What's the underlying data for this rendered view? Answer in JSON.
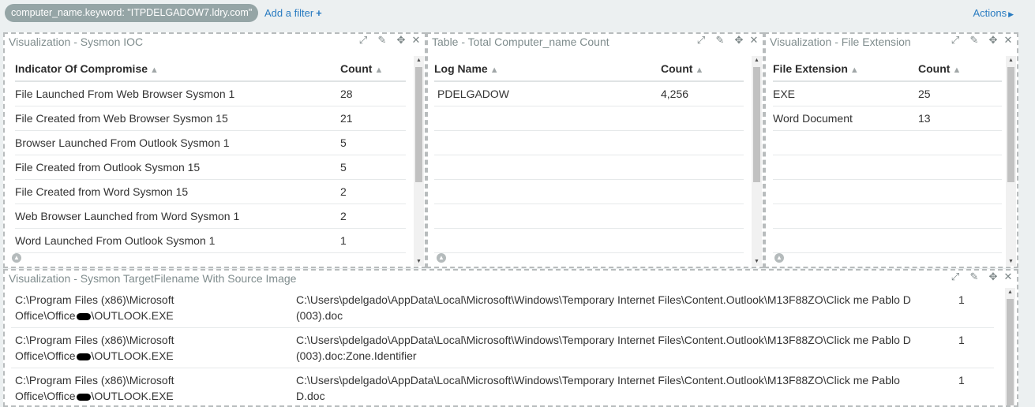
{
  "filter_bar": {
    "filter_pill": "computer_name.keyword: \"ITPDELGADOW7.ldry.com\"",
    "add_filter_label": "Add a filter",
    "add_filter_icon": "plus-icon",
    "actions_label": "Actions",
    "actions_icon": "caret-right-icon"
  },
  "panel_icons": [
    "expand-icon",
    "pencil-icon",
    "move-icon",
    "close-icon"
  ],
  "panel_ioc": {
    "title": "Visualization - Sysmon IOC",
    "columns": [
      "Indicator Of Compromise",
      "Count"
    ],
    "rows": [
      [
        "File Launched From Web Browser Sysmon 1",
        "28"
      ],
      [
        "File Created from Web Browser Sysmon 15",
        "21"
      ],
      [
        "Browser Launched From Outlook Sysmon 1",
        "5"
      ],
      [
        "File Created from Outlook Sysmon 15",
        "5"
      ],
      [
        "File Created from Word Sysmon 15",
        "2"
      ],
      [
        "Web Browser Launched from Word Sysmon 1",
        "2"
      ],
      [
        "Word Launched From Outlook Sysmon 1",
        "1"
      ]
    ]
  },
  "panel_count": {
    "title": "Table - Total Computer_name Count",
    "columns": [
      "Log Name",
      "Count"
    ],
    "rows": [
      [
        "PDELGADOW",
        "4,256"
      ],
      [
        "",
        ""
      ],
      [
        "",
        ""
      ],
      [
        "",
        ""
      ],
      [
        "",
        ""
      ],
      [
        "",
        ""
      ],
      [
        "",
        ""
      ]
    ]
  },
  "panel_ext": {
    "title": "Visualization - File Extension",
    "columns": [
      "File Extension",
      "Count"
    ],
    "rows": [
      [
        "EXE",
        "25"
      ],
      [
        "Word Document",
        "13"
      ],
      [
        "",
        ""
      ],
      [
        "",
        ""
      ],
      [
        "",
        ""
      ],
      [
        "",
        ""
      ],
      [
        "",
        ""
      ]
    ]
  },
  "panel_target": {
    "title": "Visualization - Sysmon TargetFilename With Source Image",
    "rows": [
      {
        "source_line1": "C:\\Program Files (x86)\\Microsoft",
        "source_line2a": "Office\\Office",
        "source_line2b": "\\OUTLOOK.EXE",
        "target_line1": "C:\\Users\\pdelgado\\AppData\\Local\\Microsoft\\Windows\\Temporary Internet Files\\Content.Outlook\\M13F88ZO\\Click me Pablo D",
        "target_line2": "(003).doc",
        "count": "1"
      },
      {
        "source_line1": "C:\\Program Files (x86)\\Microsoft",
        "source_line2a": "Office\\Office",
        "source_line2b": "\\OUTLOOK.EXE",
        "target_line1": "C:\\Users\\pdelgado\\AppData\\Local\\Microsoft\\Windows\\Temporary Internet Files\\Content.Outlook\\M13F88ZO\\Click me Pablo D",
        "target_line2": "(003).doc:Zone.Identifier",
        "count": "1"
      },
      {
        "source_line1": "C:\\Program Files (x86)\\Microsoft",
        "source_line2a": "Office\\Office",
        "source_line2b": "\\OUTLOOK.EXE",
        "target_line1": "C:\\Users\\pdelgado\\AppData\\Local\\Microsoft\\Windows\\Temporary Internet Files\\Content.Outlook\\M13F88ZO\\Click me Pablo",
        "target_line2": "D.doc",
        "count": "1"
      }
    ]
  }
}
